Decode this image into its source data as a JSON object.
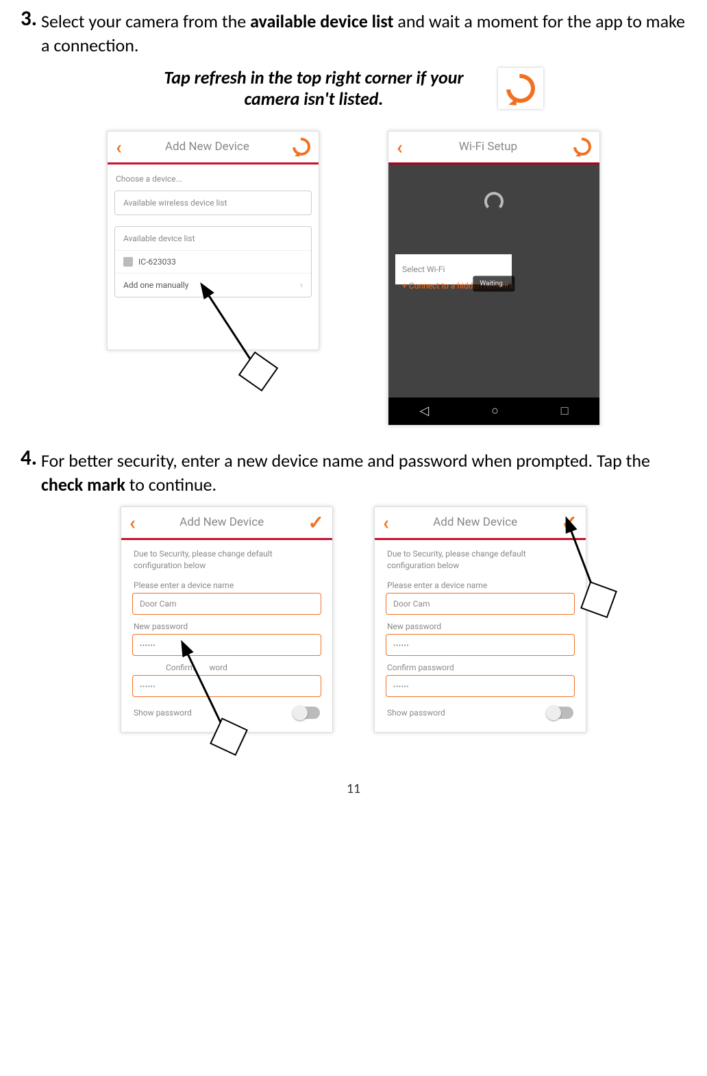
{
  "step3": {
    "num": "3.",
    "text_pre": "Select your camera from the ",
    "bold": "available device list",
    "text_post": " and wait a moment for the app to make a connection."
  },
  "tip": {
    "line1": "Tap refresh in the top right corner if your",
    "line2": "camera isn't listed."
  },
  "addDevice": {
    "title": "Add New Device",
    "choose": "Choose a device...",
    "wirelessHeader": "Available wireless device list",
    "deviceHeader": "Available device list",
    "deviceId": "IC-623033",
    "addManually": "Add one manually"
  },
  "wifi": {
    "title": "Wi-Fi Setup",
    "selectWifi": "Select Wi-Fi",
    "hiddenLink": "+ Connect to a hidden network",
    "waiting": "Waiting..."
  },
  "step4": {
    "num": "4.",
    "text_pre": "For better security, enter a new device name and password when prompted. Tap the ",
    "bold": "check mark",
    "text_post": " to continue."
  },
  "sec": {
    "note": "Due to Security, please change default configuration below",
    "nameLabel": "Please enter a device name",
    "nameVal": "Door Cam",
    "pwLabel": "New password",
    "confirmLabel": "Confirm password",
    "showPw": "Show password"
  },
  "page": {
    "num": "11"
  }
}
